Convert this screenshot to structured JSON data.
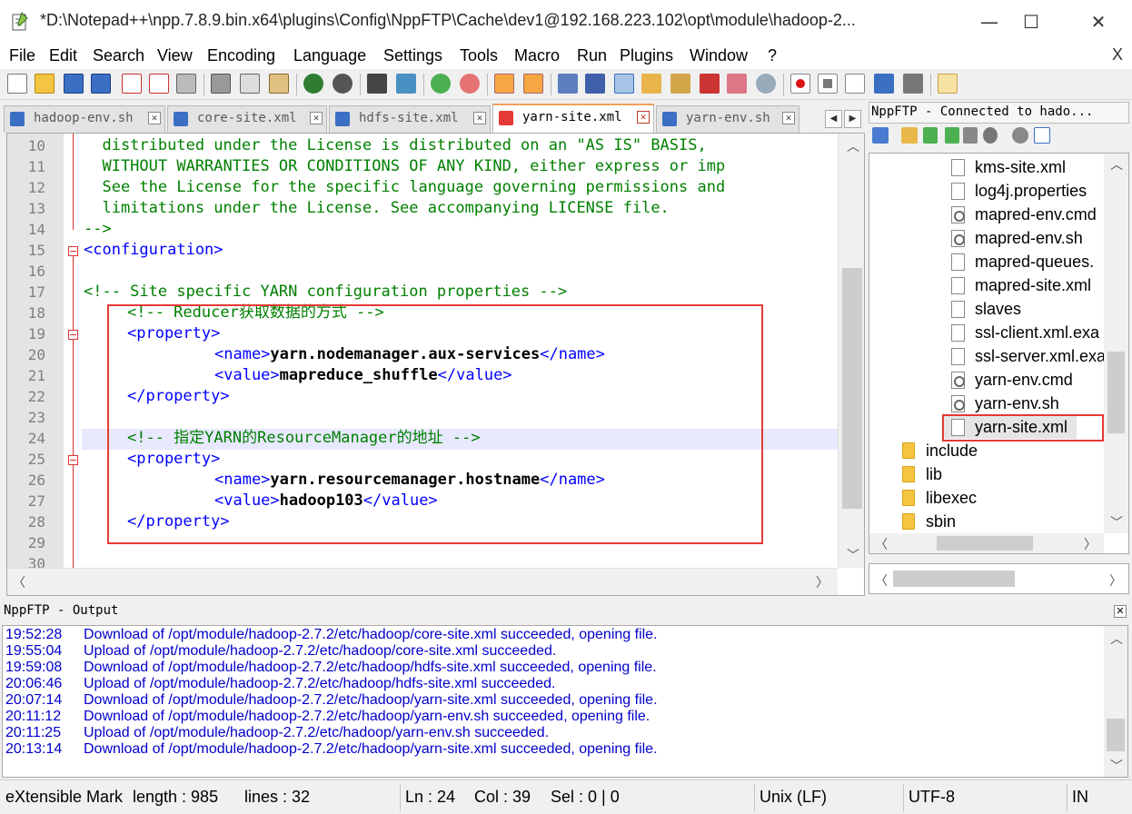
{
  "window": {
    "title": "*D:\\Notepad++\\npp.7.8.9.bin.x64\\plugins\\Config\\NppFTP\\Cache\\dev1@192.168.223.102\\opt\\module\\hadoop-2...",
    "minimize": "—",
    "maximize": "☐",
    "close": "✕"
  },
  "menu": [
    "File",
    "Edit",
    "Search",
    "View",
    "Encoding",
    "Language",
    "Settings",
    "Tools",
    "Macro",
    "Run",
    "Plugins",
    "Window",
    "?"
  ],
  "menu_close": "X",
  "tabs": [
    {
      "label": "hadoop-env.sh",
      "active": false
    },
    {
      "label": "core-site.xml",
      "active": false
    },
    {
      "label": "hdfs-site.xml",
      "active": false
    },
    {
      "label": "yarn-site.xml",
      "active": true
    },
    {
      "label": "yarn-env.sh",
      "active": false
    }
  ],
  "tab_close": "✕",
  "editor": {
    "line_numbers": [
      "10",
      "11",
      "12",
      "13",
      "14",
      "15",
      "16",
      "17",
      "18",
      "19",
      "20",
      "21",
      "22",
      "23",
      "24",
      "25",
      "26",
      "27",
      "28",
      "29",
      "30"
    ],
    "lines": {
      "l10": "  distributed under the License is distributed on an \"AS IS\" BASIS,",
      "l11": "  WITHOUT WARRANTIES OR CONDITIONS OF ANY KIND, either express or imp",
      "l12": "  See the License for the specific language governing permissions and",
      "l13": "  limitations under the License. See accompanying LICENSE file.",
      "l14": "-->",
      "l15_open": "<configuration>",
      "l17": "<!-- Site specific YARN configuration properties -->",
      "l18": "<!-- Reducer获取数据的方式 -->",
      "prop_open": "<property>",
      "prop_close": "</property>",
      "name_open": "<name>",
      "name_close": "</name>",
      "value_open": "<value>",
      "value_close": "</value>",
      "l20_text": "yarn.nodemanager.aux-services",
      "l21_text": "mapreduce_shuffle",
      "l24": "<!-- 指定YARN的ResourceManager的地址 -->",
      "l26_text": "yarn.resourcemanager.hostname",
      "l27_text": "hadoop103"
    }
  },
  "ftp": {
    "header": "NppFTP - Connected to hado...",
    "files": [
      {
        "name": "kms-site.xml",
        "icon": "file-icon"
      },
      {
        "name": "log4j.properties",
        "icon": "file-icon"
      },
      {
        "name": "mapred-env.cmd",
        "icon": "gear-file-icon"
      },
      {
        "name": "mapred-env.sh",
        "icon": "gear-file-icon"
      },
      {
        "name": "mapred-queues.",
        "icon": "file-icon"
      },
      {
        "name": "mapred-site.xml",
        "icon": "file-icon"
      },
      {
        "name": "slaves",
        "icon": "file-icon"
      },
      {
        "name": "ssl-client.xml.exa",
        "icon": "file-icon"
      },
      {
        "name": "ssl-server.xml.exa",
        "icon": "file-icon"
      },
      {
        "name": "yarn-env.cmd",
        "icon": "gear-file-icon"
      },
      {
        "name": "yarn-env.sh",
        "icon": "gear-file-icon"
      },
      {
        "name": "yarn-site.xml",
        "icon": "file-icon",
        "selected": true
      }
    ],
    "folders": [
      "include",
      "lib",
      "libexec",
      "sbin"
    ]
  },
  "output": {
    "header": "NppFTP - Output",
    "lines": [
      {
        "time": "19:52:28",
        "msg": "Download of /opt/module/hadoop-2.7.2/etc/hadoop/core-site.xml succeeded, opening file."
      },
      {
        "time": "19:55:04",
        "msg": "Upload of /opt/module/hadoop-2.7.2/etc/hadoop/core-site.xml succeeded."
      },
      {
        "time": "19:59:08",
        "msg": "Download of /opt/module/hadoop-2.7.2/etc/hadoop/hdfs-site.xml succeeded, opening file."
      },
      {
        "time": "20:06:46",
        "msg": "Upload of /opt/module/hadoop-2.7.2/etc/hadoop/hdfs-site.xml succeeded."
      },
      {
        "time": "20:07:14",
        "msg": "Download of /opt/module/hadoop-2.7.2/etc/hadoop/yarn-site.xml succeeded, opening file."
      },
      {
        "time": "20:11:12",
        "msg": "Download of /opt/module/hadoop-2.7.2/etc/hadoop/yarn-env.sh succeeded, opening file."
      },
      {
        "time": "20:11:25",
        "msg": "Upload of /opt/module/hadoop-2.7.2/etc/hadoop/yarn-env.sh succeeded."
      },
      {
        "time": "20:13:14",
        "msg": "Download of /opt/module/hadoop-2.7.2/etc/hadoop/yarn-site.xml succeeded, opening file."
      }
    ]
  },
  "status": {
    "lang": "eXtensible Mark",
    "length": "length : 985",
    "lines": "lines : 32",
    "ln": "Ln : 24",
    "col": "Col : 39",
    "sel": "Sel : 0 | 0",
    "eol": "Unix (LF)",
    "encoding": "UTF-8",
    "ins": "IN"
  },
  "colors": {
    "comment": "#008000",
    "tag": "#0000ff",
    "highlight_box": "#e53935",
    "current_line": "#e8e8ff",
    "output_text": "#0000cc"
  }
}
